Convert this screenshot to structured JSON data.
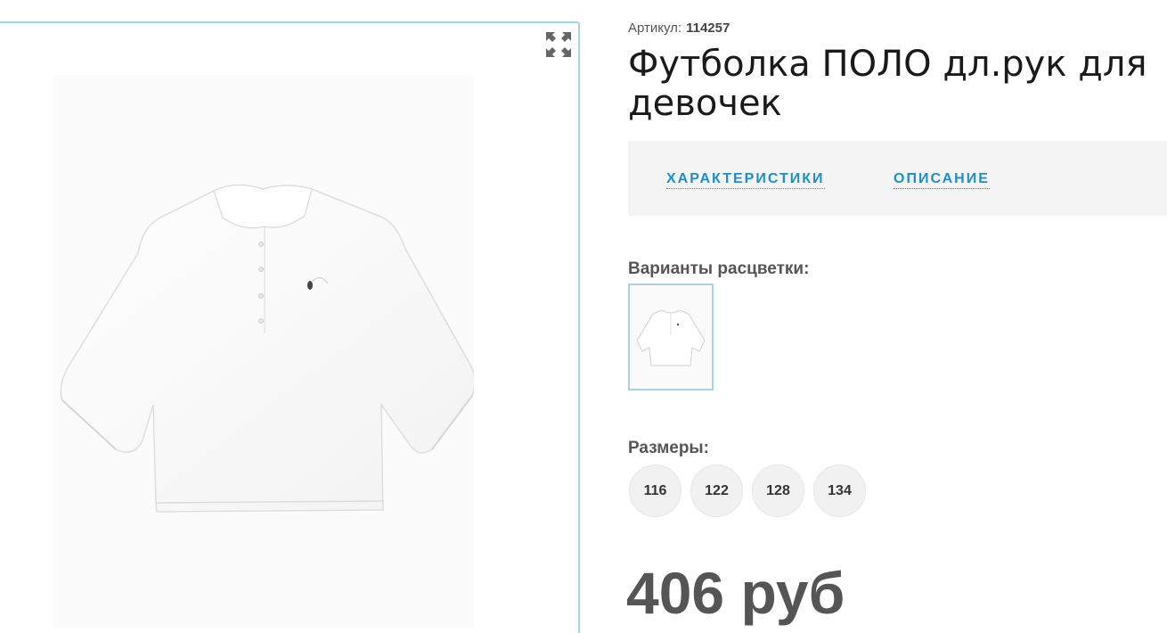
{
  "product": {
    "sku_label": "Артикул:",
    "sku_value": "114257",
    "title_line1": "Футболка ПОЛО дл.рук для",
    "title_line2": "девочек",
    "price": "406 руб"
  },
  "tabs": [
    {
      "label": "ХАРАКТЕРИСТИКИ"
    },
    {
      "label": "ОПИСАНИЕ"
    }
  ],
  "colors": {
    "label": "Варианты расцветки:"
  },
  "sizes": {
    "label": "Размеры:",
    "options": [
      "116",
      "122",
      "128",
      "134"
    ]
  },
  "gallery": {
    "fullscreen_icon": "fullscreen-icon",
    "image": "white-long-sleeve-polo-shirt"
  },
  "theme": {
    "accent": "#1c8fc8",
    "border": "#a6d4e6",
    "tab_bar_bg": "#f4f4f4",
    "chip_bg": "#f1f1f1"
  }
}
